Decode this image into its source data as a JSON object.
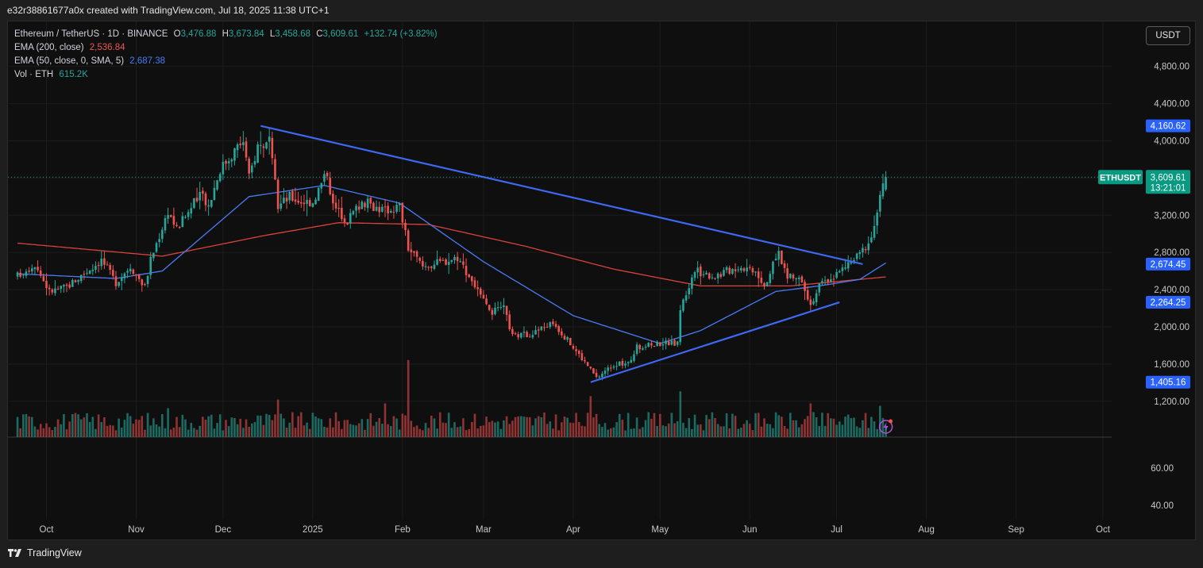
{
  "header": {
    "caption": "e32r38861677a0x created with TradingView.com, Jul 18, 2025 11:38 UTC+1"
  },
  "legend": {
    "symbol": "Ethereum / TetherUS · 1D · BINANCE",
    "open_label": "O",
    "open": "3,476.88",
    "high_label": "H",
    "high": "3,673.84",
    "low_label": "L",
    "low": "3,458.68",
    "close_label": "C",
    "close": "3,609.61",
    "change": "+132.74 (+3.82%)",
    "ema200_label": "EMA (200, close)",
    "ema200_value": "2,536.84",
    "ema50_label": "EMA (50, close, 0, SMA, 5)",
    "ema50_value": "2,687.38",
    "vol_label": "Vol · ETH",
    "vol_value": "615.2K"
  },
  "currency_button": "USDT",
  "footer": {
    "brand": "TradingView"
  },
  "colors": {
    "up": "#26a69a",
    "down": "#ef5350",
    "ema50": "#4a7bf7",
    "ema200": "#d9433b",
    "trendline": "#3d68f2",
    "background": "#0f0f0f"
  },
  "chart_data": {
    "type": "candlestick",
    "symbol": "ETHUSDT",
    "interval": "1D",
    "x_ticks": [
      "Oct",
      "Nov",
      "Dec",
      "2025",
      "Feb",
      "Mar",
      "Apr",
      "May",
      "Jun",
      "Jul",
      "Aug",
      "Sep",
      "Oct"
    ],
    "price_ticks": [
      "4,800.00",
      "4,400.00",
      "4,000.00",
      "3,200.00",
      "2,800.00",
      "2,400.00",
      "2,000.00",
      "1,600.00",
      "1,200.00"
    ],
    "volume_ticks": [
      "60.00",
      "40.00"
    ],
    "price_labels": [
      {
        "text": "4,160.62",
        "price": 4160.62,
        "color": "#2962ff"
      },
      {
        "text": "2,674.45",
        "price": 2674.45,
        "color": "#2962ff"
      },
      {
        "text": "2,264.25",
        "price": 2264.25,
        "color": "#2962ff"
      },
      {
        "text": "1,405.16",
        "price": 1405.16,
        "color": "#2962ff"
      }
    ],
    "last_price": {
      "symbol": "ETHUSDT",
      "price": "3,609.61",
      "value": 3609.61,
      "countdown": "13:21:01"
    },
    "ohlc_last": {
      "open": 3476.88,
      "high": 3673.84,
      "low": 3458.68,
      "close": 3609.61
    },
    "anchors": [
      [
        "2024-09-21",
        2550
      ],
      [
        "2024-09-27",
        2680
      ],
      [
        "2024-10-02",
        2380
      ],
      [
        "2024-10-08",
        2430
      ],
      [
        "2024-10-15",
        2600
      ],
      [
        "2024-10-20",
        2720
      ],
      [
        "2024-10-25",
        2480
      ],
      [
        "2024-10-30",
        2660
      ],
      [
        "2024-11-04",
        2430
      ],
      [
        "2024-11-06",
        2720
      ],
      [
        "2024-11-12",
        3250
      ],
      [
        "2024-11-15",
        3050
      ],
      [
        "2024-11-21",
        3330
      ],
      [
        "2024-11-24",
        3430
      ],
      [
        "2024-11-26",
        3300
      ],
      [
        "2024-11-30",
        3700
      ],
      [
        "2024-12-05",
        3900
      ],
      [
        "2024-12-08",
        4000
      ],
      [
        "2024-12-10",
        3600
      ],
      [
        "2024-12-13",
        3950
      ],
      [
        "2024-12-17",
        3980
      ],
      [
        "2024-12-20",
        3300
      ],
      [
        "2024-12-24",
        3400
      ],
      [
        "2024-12-28",
        3350
      ],
      [
        "2025-01-01",
        3350
      ],
      [
        "2025-01-06",
        3670
      ],
      [
        "2025-01-08",
        3300
      ],
      [
        "2025-01-13",
        3150
      ],
      [
        "2025-01-18",
        3350
      ],
      [
        "2025-01-22",
        3300
      ],
      [
        "2025-01-26",
        3250
      ],
      [
        "2025-01-31",
        3300
      ],
      [
        "2025-02-03",
        2850
      ],
      [
        "2025-02-08",
        2650
      ],
      [
        "2025-02-15",
        2700
      ],
      [
        "2025-02-20",
        2750
      ],
      [
        "2025-02-25",
        2500
      ],
      [
        "2025-03-03",
        2150
      ],
      [
        "2025-03-08",
        2200
      ],
      [
        "2025-03-11",
        1900
      ],
      [
        "2025-03-18",
        1930
      ],
      [
        "2025-03-25",
        2050
      ],
      [
        "2025-03-31",
        1820
      ],
      [
        "2025-04-06",
        1580
      ],
      [
        "2025-04-09",
        1450
      ],
      [
        "2025-04-15",
        1600
      ],
      [
        "2025-04-20",
        1600
      ],
      [
        "2025-04-23",
        1780
      ],
      [
        "2025-05-02",
        1830
      ],
      [
        "2025-05-07",
        1820
      ],
      [
        "2025-05-08",
        2200
      ],
      [
        "2025-05-13",
        2600
      ],
      [
        "2025-05-20",
        2550
      ],
      [
        "2025-05-28",
        2650
      ],
      [
        "2025-06-03",
        2620
      ],
      [
        "2025-06-06",
        2450
      ],
      [
        "2025-06-11",
        2800
      ],
      [
        "2025-06-14",
        2530
      ],
      [
        "2025-06-19",
        2520
      ],
      [
        "2025-06-22",
        2240
      ],
      [
        "2025-06-25",
        2440
      ],
      [
        "2025-07-02",
        2590
      ],
      [
        "2025-07-09",
        2780
      ],
      [
        "2025-07-13",
        2960
      ],
      [
        "2025-07-16",
        3380
      ],
      [
        "2025-07-18",
        3609.61
      ]
    ],
    "ema200_anchors": [
      [
        "2024-09-21",
        2900
      ],
      [
        "2024-11-10",
        2760
      ],
      [
        "2024-12-15",
        2980
      ],
      [
        "2025-01-10",
        3120
      ],
      [
        "2025-02-10",
        3100
      ],
      [
        "2025-03-15",
        2870
      ],
      [
        "2025-04-15",
        2620
      ],
      [
        "2025-05-15",
        2440
      ],
      [
        "2025-06-15",
        2440
      ],
      [
        "2025-07-18",
        2536.84
      ]
    ],
    "ema50_anchors": [
      [
        "2024-09-21",
        2570
      ],
      [
        "2024-10-25",
        2520
      ],
      [
        "2024-11-10",
        2600
      ],
      [
        "2024-12-10",
        3400
      ],
      [
        "2025-01-05",
        3520
      ],
      [
        "2025-01-31",
        3330
      ],
      [
        "2025-03-01",
        2700
      ],
      [
        "2025-04-01",
        2120
      ],
      [
        "2025-05-01",
        1820
      ],
      [
        "2025-05-15",
        1960
      ],
      [
        "2025-06-10",
        2380
      ],
      [
        "2025-06-25",
        2440
      ],
      [
        "2025-07-09",
        2510
      ],
      [
        "2025-07-18",
        2687.38
      ]
    ],
    "trendlines": [
      {
        "from": [
          "2024-12-14",
          4160.62
        ],
        "to": [
          "2025-07-10",
          2674.45
        ]
      },
      {
        "from": [
          "2025-04-07",
          1405.16
        ],
        "to": [
          "2025-07-02",
          2264.25
        ]
      }
    ],
    "volume_spikes": [
      [
        "2025-02-03",
        160
      ],
      [
        "2024-12-20",
        78
      ],
      [
        "2024-11-12",
        60
      ],
      [
        "2025-01-26",
        70
      ],
      [
        "2025-04-07",
        85
      ],
      [
        "2025-05-08",
        95
      ],
      [
        "2025-06-22",
        70
      ],
      [
        "2025-07-16",
        65
      ]
    ]
  }
}
